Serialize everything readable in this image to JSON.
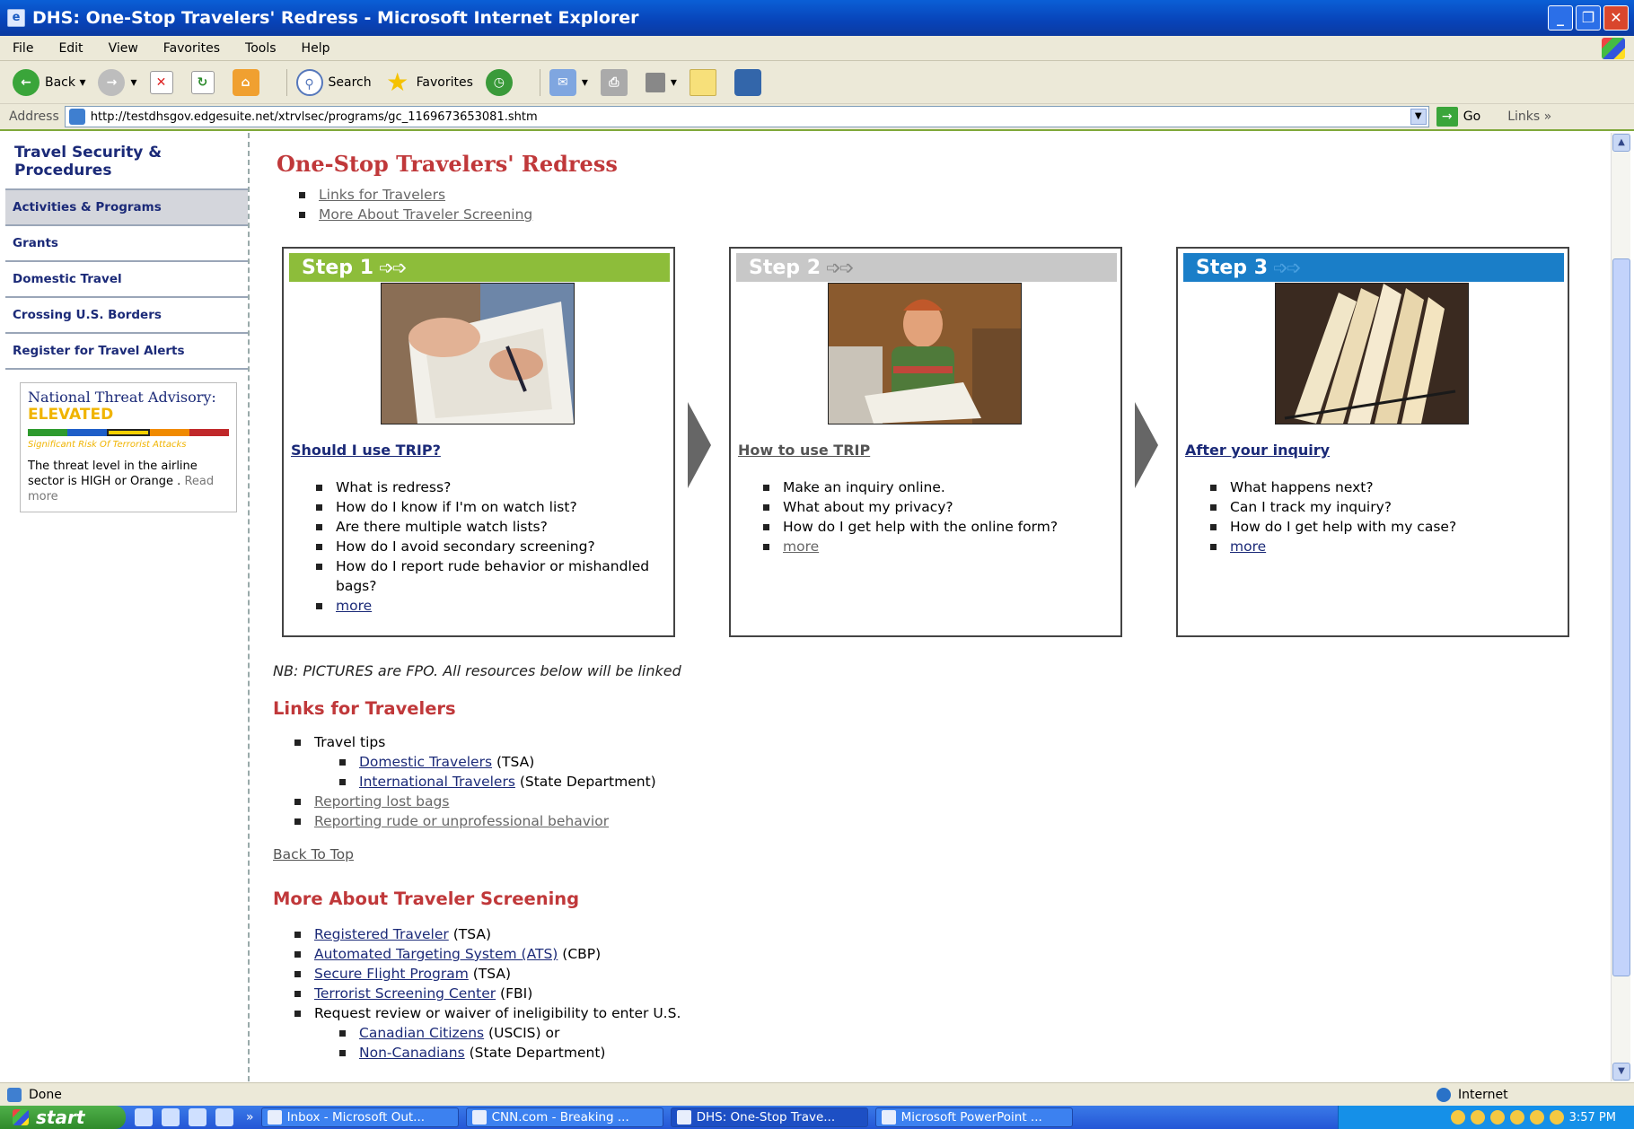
{
  "window": {
    "title": "DHS: One-Stop Travelers' Redress - Microsoft Internet Explorer"
  },
  "menu": [
    "File",
    "Edit",
    "View",
    "Favorites",
    "Tools",
    "Help"
  ],
  "toolbar": {
    "back": "Back",
    "search": "Search",
    "favorites": "Favorites"
  },
  "address": {
    "label": "Address",
    "url": "http://testdhsgov.edgesuite.net/xtrvlsec/programs/gc_1169673653081.shtm",
    "go": "Go",
    "links": "Links"
  },
  "sidebar": {
    "title": "Travel Security & Procedures",
    "items": [
      {
        "label": "Activities & Programs"
      },
      {
        "label": "Grants"
      },
      {
        "label": "Domestic Travel"
      },
      {
        "label": "Crossing U.S. Borders"
      },
      {
        "label": "Register for Travel Alerts"
      }
    ],
    "threat": {
      "title": "National Threat Advisory:",
      "level": "ELEVATED",
      "risk": "Significant Risk Of Terrorist Attacks",
      "text": "The threat level in the airline sector is HIGH or Orange .",
      "read_more": "Read more",
      "colors": [
        "#2e9a2e",
        "#1e5ec8",
        "#f7d000",
        "#f08a00",
        "#c0282a"
      ]
    }
  },
  "main": {
    "title": "One-Stop Travelers' Redress",
    "top_links": [
      "Links for Travelers",
      "More About Traveler Screening"
    ],
    "steps": [
      {
        "label": "Step 1",
        "color": "#8dbd3a",
        "question": "Should I use TRIP?",
        "items": [
          "What is redress?",
          "How do I know if I'm on watch list?",
          "Are there multiple watch lists?",
          "How do I avoid secondary screening?",
          "How do I report rude behavior or mishandled bags?"
        ],
        "more": "more"
      },
      {
        "label": "Step 2",
        "color": "#c8c8c8",
        "question": "How to use TRIP",
        "items": [
          "Make an inquiry online.",
          "What about my privacy?",
          "How do I get help with the online form?"
        ],
        "more": "more"
      },
      {
        "label": "Step 3",
        "color": "#1a7ec8",
        "question": "After your inquiry",
        "items": [
          "What happens next?",
          "Can I track my inquiry?",
          "How do I get help with my case?"
        ],
        "more": "more"
      }
    ],
    "note": "NB:  PICTURES are FPO. All resources below will be linked",
    "links_section": {
      "title": "Links for Travelers",
      "travel_tips": "Travel tips",
      "domestic": "Domestic Travelers",
      "domestic_suffix": " (TSA)",
      "international": "International Travelers",
      "international_suffix": " (State Department)",
      "lost_bags": "Reporting lost bags",
      "rude": "Reporting rude or unprofessional behavior"
    },
    "back_to_top": "Back To Top",
    "screening_section": {
      "title": "More About Traveler Screening",
      "items": [
        {
          "link": "Registered Traveler",
          "suffix": " (TSA)"
        },
        {
          "link": "Automated Targeting System (ATS)",
          "suffix": " (CBP)"
        },
        {
          "link": "Secure Flight Program",
          "suffix": " (TSA)"
        },
        {
          "link": "Terrorist Screening Center",
          "suffix": " (FBI)"
        }
      ],
      "waiver": "Request review or waiver of ineligibility to enter U.S.",
      "canadian": "Canadian Citizens",
      "canadian_suffix": "  (USCIS) or",
      "noncanadian": "Non-Canadians",
      "noncanadian_suffix": " (State Department)"
    }
  },
  "status": {
    "text": "Done",
    "zone": "Internet"
  },
  "taskbar": {
    "start": "start",
    "buttons": [
      "Inbox - Microsoft Out...",
      "CNN.com - Breaking ...",
      "DHS: One-Stop Trave...",
      "Microsoft PowerPoint ..."
    ],
    "time": "3:57 PM"
  }
}
